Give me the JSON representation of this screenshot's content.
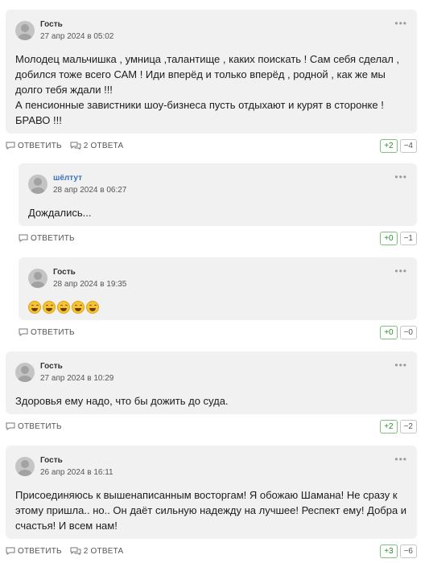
{
  "comments": [
    {
      "author": "Гость",
      "date": "27 апр 2024 в 05:02",
      "text": "Молодец мальчишка , умница ,талантище , каких поискать ! Сам себя сделал , добился тоже всего САМ ! Иди вперёд и только вперёд , родной , как же мы долго тебя ждали !!!\nА пенсионные завистники шоу-бизнеса пусть отдыхают и курят в сторонке !\nБРАВО !!!",
      "reply_label": "ОТВЕТИТЬ",
      "replies_label": "2 ОТВЕТА",
      "plus": "+2",
      "minus": "−4"
    },
    {
      "author": "шёлтут",
      "date": "28 апр 2024 в 06:27",
      "text": "Дождались...",
      "reply_label": "ОТВЕТИТЬ",
      "plus": "+0",
      "minus": "−1"
    },
    {
      "author": "Гость",
      "date": "28 апр 2024 в 19:35",
      "emoji_count": 5,
      "emoji_icon": "rolling-on-floor-laughing-emoji",
      "reply_label": "ОТВЕТИТЬ",
      "plus": "+0",
      "minus": "−0"
    },
    {
      "author": "Гость",
      "date": "27 апр 2024 в 10:29",
      "text": "Здоровья ему надо, что бы дожить до суда.",
      "reply_label": "ОТВЕТИТЬ",
      "plus": "+2",
      "minus": "−2"
    },
    {
      "author": "Гость",
      "date": "26 апр 2024 в 16:11",
      "text": "Присоединяюсь к вышенаписанным восторгам! Я обожаю Шамана! Не сразу к этому пришла.. но.. Он даёт сильную надежду на лучшее! Респект ему! Добра и счастья! И всем нам!",
      "reply_label": "ОТВЕТИТЬ",
      "replies_label": "2 ОТВЕТА",
      "plus": "+3",
      "minus": "−6"
    }
  ],
  "icons": {
    "reply": "reply-icon",
    "replies": "comments-icon",
    "more": "more-options-icon"
  },
  "colors": {
    "card_bg": "#f1f1f1",
    "plus_border": "#7cc07c",
    "user_link": "#3b74b8"
  }
}
